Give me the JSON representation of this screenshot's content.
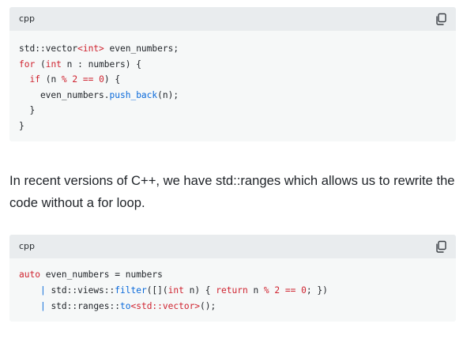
{
  "blocks": [
    {
      "language": "cpp",
      "copy_icon": "copy-icon",
      "tokens": [
        [
          {
            "t": "std::vector",
            "c": ""
          },
          {
            "t": "<int>",
            "c": "ty"
          },
          {
            "t": " even_numbers;",
            "c": ""
          }
        ],
        [
          {
            "t": "for",
            "c": "kw"
          },
          {
            "t": " (",
            "c": ""
          },
          {
            "t": "int",
            "c": "kw"
          },
          {
            "t": " n : numbers) {",
            "c": ""
          }
        ],
        [
          {
            "t": "  ",
            "c": ""
          },
          {
            "t": "if",
            "c": "kw"
          },
          {
            "t": " (n ",
            "c": ""
          },
          {
            "t": "%",
            "c": "op"
          },
          {
            "t": " ",
            "c": ""
          },
          {
            "t": "2",
            "c": "num"
          },
          {
            "t": " ",
            "c": ""
          },
          {
            "t": "==",
            "c": "op"
          },
          {
            "t": " ",
            "c": ""
          },
          {
            "t": "0",
            "c": "num"
          },
          {
            "t": ") {",
            "c": ""
          }
        ],
        [
          {
            "t": "    even_numbers.",
            "c": ""
          },
          {
            "t": "push_back",
            "c": "fn"
          },
          {
            "t": "(n);",
            "c": ""
          }
        ],
        [
          {
            "t": "  }",
            "c": ""
          }
        ],
        [
          {
            "t": "}",
            "c": ""
          }
        ]
      ]
    },
    {
      "language": "cpp",
      "copy_icon": "copy-icon",
      "tokens": [
        [
          {
            "t": "auto",
            "c": "kw"
          },
          {
            "t": " even_numbers = numbers",
            "c": ""
          }
        ],
        [
          {
            "t": "    ",
            "c": ""
          },
          {
            "t": "|",
            "c": "fn"
          },
          {
            "t": " std::views::",
            "c": ""
          },
          {
            "t": "filter",
            "c": "fn"
          },
          {
            "t": "([](",
            "c": ""
          },
          {
            "t": "int",
            "c": "kw"
          },
          {
            "t": " n) { ",
            "c": ""
          },
          {
            "t": "return",
            "c": "kw"
          },
          {
            "t": " n ",
            "c": ""
          },
          {
            "t": "%",
            "c": "op"
          },
          {
            "t": " ",
            "c": ""
          },
          {
            "t": "2",
            "c": "num"
          },
          {
            "t": " ",
            "c": ""
          },
          {
            "t": "==",
            "c": "op"
          },
          {
            "t": " ",
            "c": ""
          },
          {
            "t": "0",
            "c": "num"
          },
          {
            "t": "; })",
            "c": ""
          }
        ],
        [
          {
            "t": "    ",
            "c": ""
          },
          {
            "t": "|",
            "c": "fn"
          },
          {
            "t": " std::ranges::",
            "c": ""
          },
          {
            "t": "to",
            "c": "fn"
          },
          {
            "t": "<std::vector>",
            "c": "ty"
          },
          {
            "t": "();",
            "c": ""
          }
        ]
      ]
    }
  ],
  "prose": {
    "text": "In recent versions of C++, we have std::ranges which allows us to rewrite the code without a for loop."
  },
  "colors": {
    "keyword": "#cf222e",
    "function": "#0969da",
    "text": "#1f2328",
    "code_bg": "#f6f8f8",
    "header_bg": "#e9ecee"
  }
}
